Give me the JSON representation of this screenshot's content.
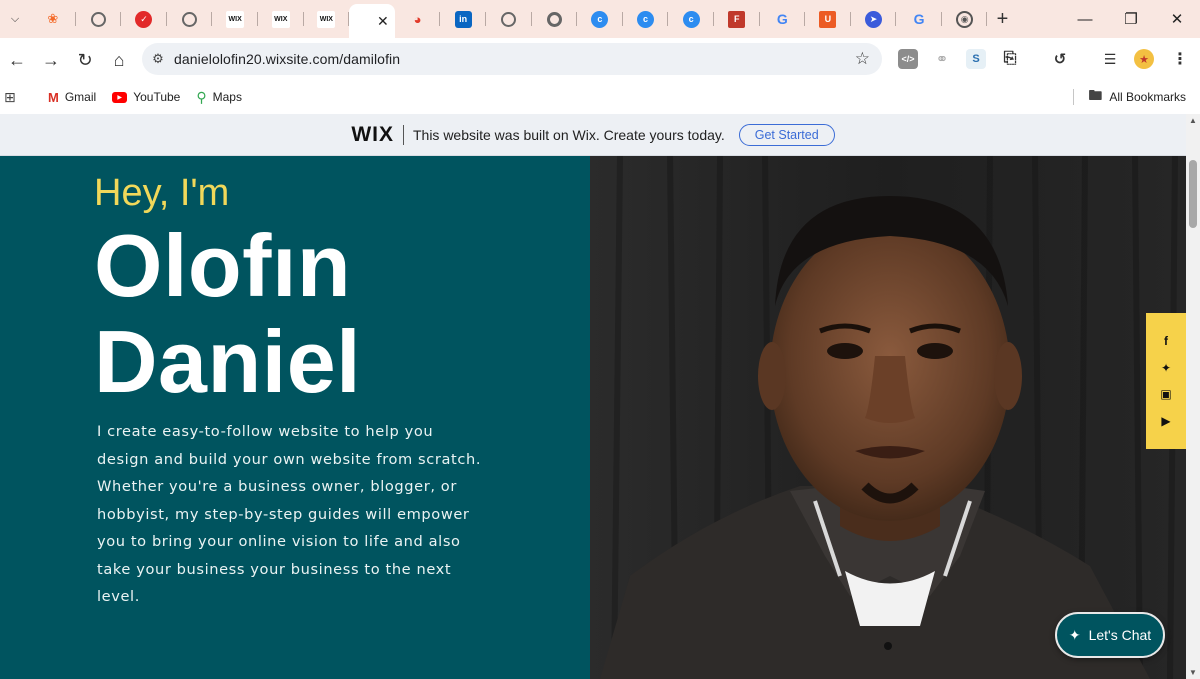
{
  "browser": {
    "tab_menu_icon": "chevron-down-icon",
    "tabs": [
      {
        "icon": "cp",
        "color": "#f46b2a",
        "label": ""
      },
      {
        "icon": "globe",
        "color": "#6b6b6b",
        "label": ""
      },
      {
        "icon": "check",
        "color": "#e22a2a",
        "label": ""
      },
      {
        "icon": "globe",
        "color": "#6b6b6b",
        "label": ""
      },
      {
        "icon": "WIX",
        "color": "#111111",
        "label": ""
      },
      {
        "icon": "WIX",
        "color": "#111111",
        "label": ""
      },
      {
        "icon": "WIX",
        "color": "#111111",
        "label": ""
      },
      {
        "icon": "active",
        "color": "#ffffff",
        "label": ""
      },
      {
        "icon": "signal",
        "color": "#e23a2a",
        "label": ""
      },
      {
        "icon": "in",
        "color": "#0a66c2",
        "label": ""
      },
      {
        "icon": "globe",
        "color": "#6b6b6b",
        "label": ""
      },
      {
        "icon": "chrome",
        "color": "#6b6b6b",
        "label": ""
      },
      {
        "icon": "c",
        "color": "#2d8cf0",
        "label": ""
      },
      {
        "icon": "c",
        "color": "#2d8cf0",
        "label": ""
      },
      {
        "icon": "c",
        "color": "#2d8cf0",
        "label": ""
      },
      {
        "icon": "F",
        "color": "#c0392b",
        "label": ""
      },
      {
        "icon": "G",
        "color": "#4285f4",
        "label": ""
      },
      {
        "icon": "U",
        "color": "#ec5b24",
        "label": ""
      },
      {
        "icon": "arrow",
        "color": "#3b5bdb",
        "label": ""
      },
      {
        "icon": "G",
        "color": "#4285f4",
        "label": ""
      },
      {
        "icon": "badge",
        "color": "#555555",
        "label": ""
      }
    ],
    "new_tab_label": "+",
    "url": "danielolofin20.wixsite.com/damilofin"
  },
  "bookmarks": {
    "items": [
      {
        "label": "Gmail",
        "icon": "gmail-icon"
      },
      {
        "label": "YouTube",
        "icon": "youtube-icon"
      },
      {
        "label": "Maps",
        "icon": "maps-icon"
      }
    ],
    "all_label": "All Bookmarks"
  },
  "wix_banner": {
    "logo": "WIX",
    "message": "This website was built on Wix. Create yours today.",
    "cta": "Get Started"
  },
  "hero": {
    "greeting": "Hey, I'm",
    "first_name": "Olofın",
    "last_name": "Daniel",
    "bio": "I create easy-to-follow website to help you design and build your own website from scratch. Whether you're a business owner, blogger, or hobbyist, my step-by-step guides will empower you to bring your online vision to life and also take your business your business to the next level."
  },
  "social": [
    "facebook-icon",
    "twitter-icon",
    "instagram-icon",
    "youtube-icon"
  ],
  "chat": {
    "label": "Let's Chat"
  },
  "colors": {
    "hero_bg": "#00545f",
    "greeting": "#f1d85a",
    "social_bar": "#f6d24a",
    "tabstrip": "#f9e7e1"
  }
}
